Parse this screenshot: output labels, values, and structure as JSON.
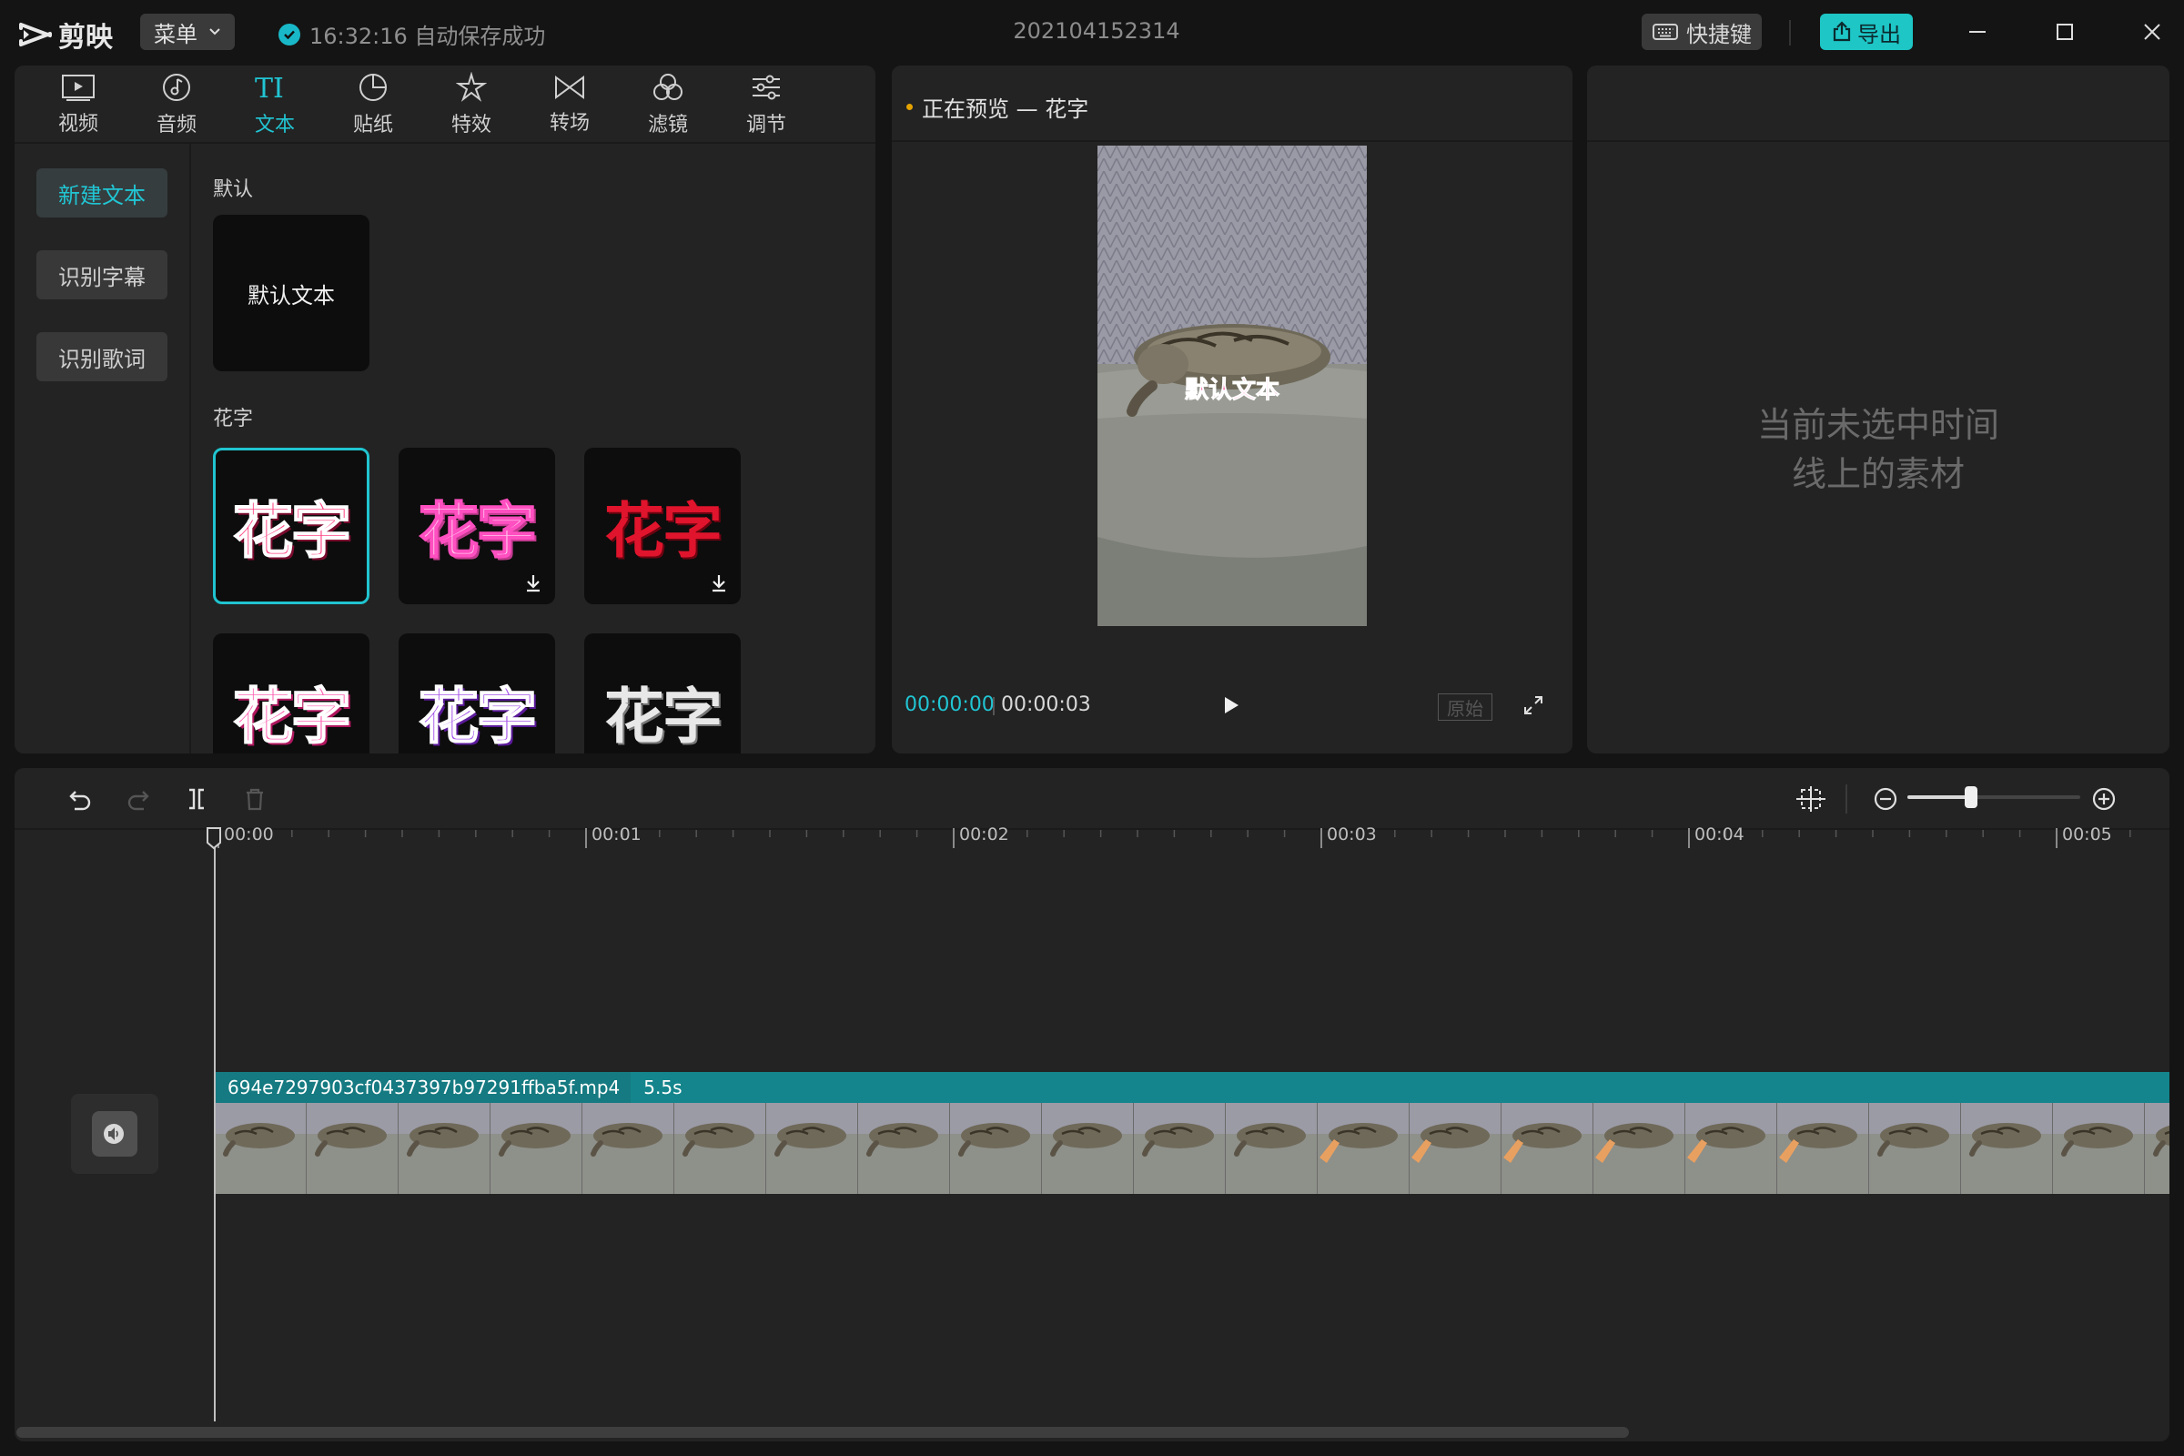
{
  "app": {
    "name": "剪映",
    "menu_label": "菜单",
    "save_status": "16:32:16 自动保存成功",
    "project_title": "202104152314"
  },
  "header": {
    "shortcut_label": "快捷键",
    "export_label": "导出"
  },
  "colors": {
    "accent": "#21c5d3",
    "panel_bg": "#232323",
    "app_bg": "#141414",
    "clip_header": "#14858c"
  },
  "tool_tabs": [
    {
      "label": "视频",
      "icon": "video-icon",
      "active": false
    },
    {
      "label": "音频",
      "icon": "audio-icon",
      "active": false
    },
    {
      "label": "文本",
      "icon": "text-icon",
      "active": true
    },
    {
      "label": "贴纸",
      "icon": "sticker-icon",
      "active": false
    },
    {
      "label": "特效",
      "icon": "effects-icon",
      "active": false
    },
    {
      "label": "转场",
      "icon": "transition-icon",
      "active": false
    },
    {
      "label": "滤镜",
      "icon": "filter-icon",
      "active": false
    },
    {
      "label": "调节",
      "icon": "adjust-icon",
      "active": false
    }
  ],
  "text_nav": [
    {
      "label": "新建文本",
      "active": true
    },
    {
      "label": "识别字幕",
      "active": false
    },
    {
      "label": "识别歌词",
      "active": false
    }
  ],
  "sections": {
    "default_label": "默认",
    "default_tile_text": "默认文本",
    "fancy_label": "花字",
    "fancy_tiles": [
      {
        "text": "花字",
        "style": "pink-white-outline",
        "selected": true,
        "download": false
      },
      {
        "text": "花字",
        "style": "light-pink-glitter",
        "selected": false,
        "download": true
      },
      {
        "text": "花字",
        "style": "red-glitter",
        "selected": false,
        "download": true
      },
      {
        "text": "花字",
        "style": "pink-glitter",
        "selected": false,
        "download": false
      },
      {
        "text": "花字",
        "style": "purple-glitter",
        "selected": false,
        "download": false
      },
      {
        "text": "花字",
        "style": "white-glitter",
        "selected": false,
        "download": false
      }
    ]
  },
  "preview": {
    "title": "正在预览 — 花字",
    "overlay_text": "默认文本",
    "current_time": "00:00:00",
    "total_time": "00:00:03",
    "ratio_label": "原始"
  },
  "properties": {
    "empty_line1": "当前未选中时间",
    "empty_line2": "线上的素材"
  },
  "timeline": {
    "ruler_labels": [
      "00:00",
      "00:01",
      "00:02",
      "00:03",
      "00:04",
      "00:05"
    ],
    "clip_filename": "694e7297903cf0437397b97291ffba5f.mp4",
    "clip_duration": "5.5s",
    "zoom_level": 0.37,
    "thumb_count": 22
  }
}
